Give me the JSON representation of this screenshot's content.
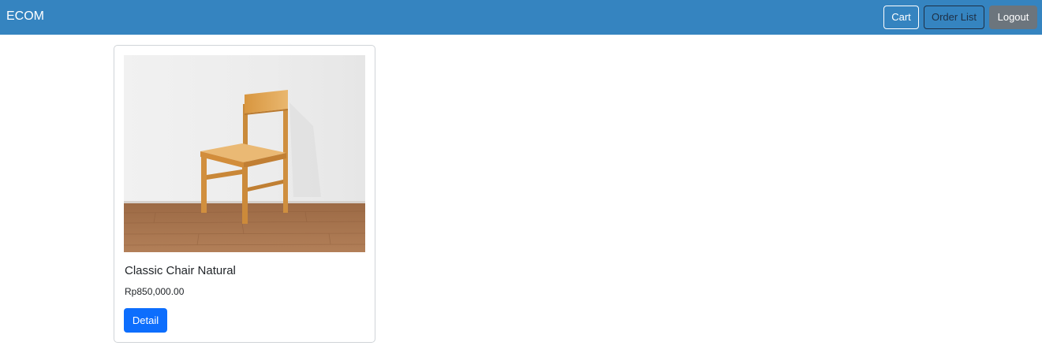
{
  "navbar": {
    "brand": "ECOM",
    "cart_label": "Cart",
    "orders_label": "Order List",
    "logout_label": "Logout",
    "background_color": "#3584c0"
  },
  "products": [
    {
      "name": "Classic Chair Natural",
      "price": "Rp850,000.00",
      "detail_label": "Detail",
      "image": "wooden-chair-photo"
    }
  ],
  "colors": {
    "primary_button": "#0d6efd",
    "logout_button": "#6c757d"
  }
}
